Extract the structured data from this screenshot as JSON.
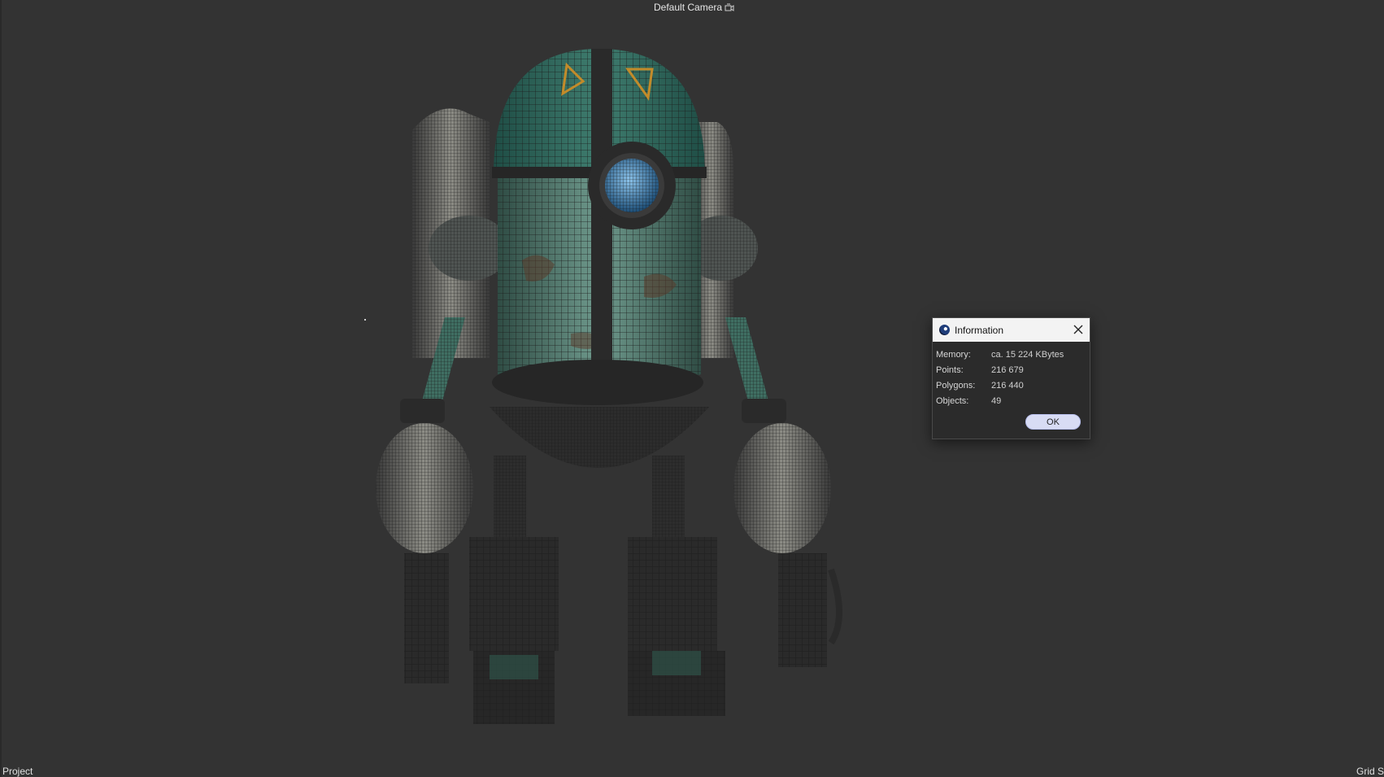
{
  "viewport": {
    "camera_label": "Default Camera",
    "camera_icon": "camera-switch-icon",
    "hud_left": "Project",
    "hud_right": "Grid Sp"
  },
  "dialog": {
    "title": "Information",
    "app_icon": "cinema4d-logo-icon",
    "close_icon": "close-icon",
    "rows": [
      {
        "label": "Memory:",
        "value": "ca. 15 224 KBytes"
      },
      {
        "label": "Points:",
        "value": "216 679"
      },
      {
        "label": "Polygons:",
        "value": "216 440"
      },
      {
        "label": "Objects:",
        "value": "49"
      }
    ],
    "ok_label": "OK"
  },
  "colors": {
    "viewport_bg": "#333333",
    "dialog_bg": "#2b2b2b",
    "titlebar_bg": "#f3f3f3",
    "ok_button_bg": "#d8dcf4",
    "robot_teal": "#4a7a6c",
    "robot_eye": "#4a8fc4"
  }
}
